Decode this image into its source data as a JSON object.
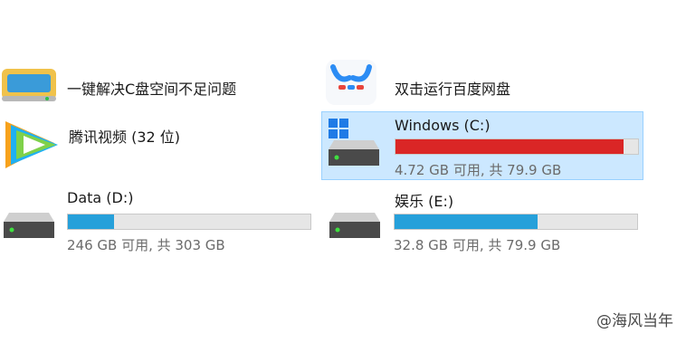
{
  "apps": [
    {
      "label": "一键解决C盘空间不足问题"
    },
    {
      "label": "双击运行百度网盘"
    },
    {
      "label": "腾讯视频 (32 位)"
    }
  ],
  "drives": [
    {
      "name": "Windows (C:)",
      "status": "4.72 GB 可用, 共 79.9 GB",
      "used_fraction": 0.94,
      "bar_color": "#da2626",
      "selected": true
    },
    {
      "name": "Data (D:)",
      "status": "246 GB 可用, 共 303 GB",
      "used_fraction": 0.19,
      "bar_color": "#26a0da"
    },
    {
      "name": "娱乐 (E:)",
      "status": "32.8 GB 可用, 共 79.9 GB",
      "used_fraction": 0.59,
      "bar_color": "#26a0da"
    }
  ],
  "watermark": "@海风当年",
  "colors": {
    "selection_bg": "#cce8ff",
    "selection_border": "#99d1ff"
  }
}
